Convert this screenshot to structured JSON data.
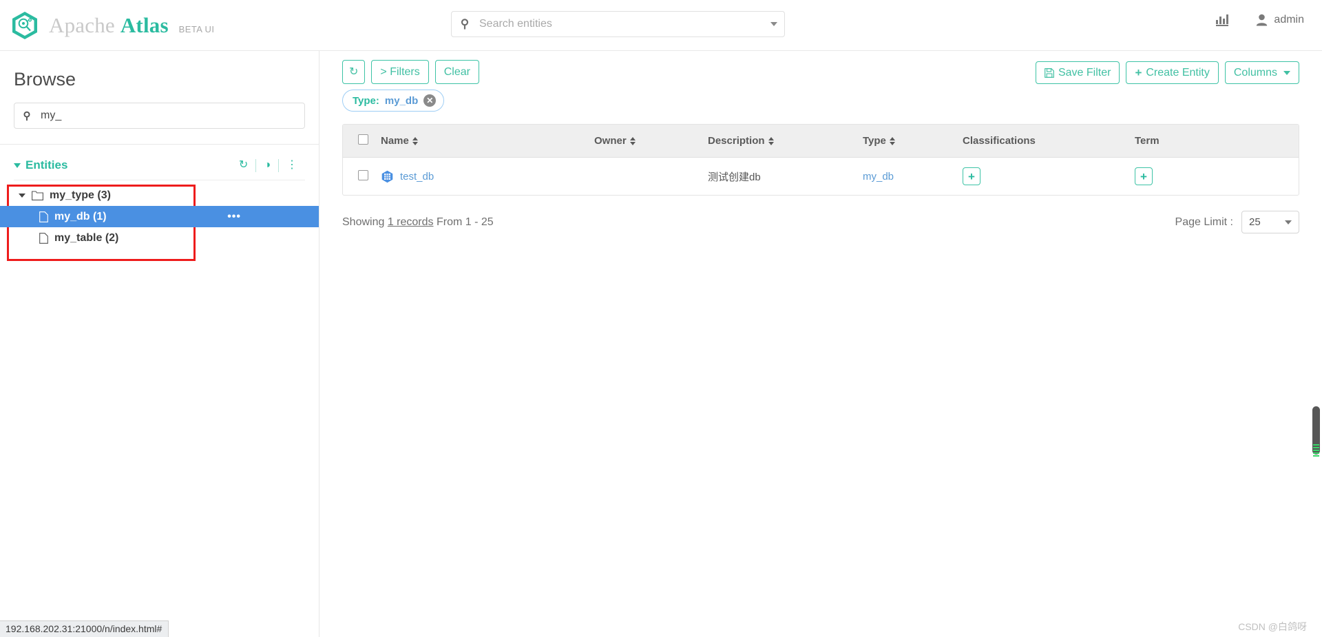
{
  "header": {
    "brand_apache": "Apache",
    "brand_atlas": "Atlas",
    "brand_beta": "BETA UI",
    "logo_icon": "hexagon-magnifier-icon",
    "search": {
      "placeholder": "Search entities",
      "value": "",
      "icon": "search-icon",
      "caret_icon": "chevron-down-icon"
    },
    "stats_icon": "bar-chart-icon",
    "user_icon": "user-icon",
    "user_name": "admin"
  },
  "sidebar": {
    "title": "Browse",
    "search": {
      "icon": "search-icon",
      "value": "my_",
      "placeholder": ""
    },
    "entities": {
      "label": "Entities",
      "caret_icon": "chevron-down-icon",
      "tools": [
        {
          "name": "refresh-icon",
          "glyph": "↻"
        },
        {
          "name": "toggle-icon",
          "glyph": "◑"
        },
        {
          "name": "more-vertical-icon",
          "glyph": "⋮"
        }
      ]
    },
    "tree": [
      {
        "label": "my_type (3)",
        "level": 1,
        "icon": "folder-icon",
        "caret_icon": "caret-down-icon",
        "selected": false,
        "dots": ""
      },
      {
        "label": "my_db (1)",
        "level": 2,
        "icon": "file-icon",
        "caret_icon": "",
        "selected": true,
        "dots": "•••"
      },
      {
        "label": "my_table (2)",
        "level": 2,
        "icon": "file-icon",
        "caret_icon": "",
        "selected": false,
        "dots": ""
      }
    ]
  },
  "toolbar": {
    "refresh_icon": "refresh-icon",
    "filters_label": "> Filters",
    "clear_label": "Clear",
    "save_filter_label": "Save Filter",
    "save_filter_icon": "floppy-disk-icon",
    "create_entity_label": "Create Entity",
    "create_entity_icon": "plus-icon",
    "columns_label": "Columns",
    "columns_caret_icon": "caret-down-icon"
  },
  "filter_chip": {
    "key": "Type:",
    "value": "my_db",
    "close_icon": "close-circle-icon"
  },
  "table": {
    "columns": [
      {
        "label": "Name",
        "sortable": true
      },
      {
        "label": "Owner",
        "sortable": true
      },
      {
        "label": "Description",
        "sortable": true
      },
      {
        "label": "Type",
        "sortable": true
      },
      {
        "label": "Classifications",
        "sortable": false
      },
      {
        "label": "Term",
        "sortable": false
      }
    ],
    "rows": [
      {
        "name": "test_db",
        "name_icon": "hexagon-table-icon",
        "owner": "",
        "description": "测试创建db",
        "type": "my_db",
        "classification_add": "+",
        "term_add": "+"
      }
    ]
  },
  "footer": {
    "showing_prefix": "Showing",
    "records": "1 records",
    "showing_suffix": "From 1 - 25",
    "page_limit_label": "Page Limit :",
    "page_limit_value": "25",
    "page_limit_caret": "caret-down-icon"
  },
  "status_bar": {
    "url": "192.168.202.31:21000/n/index.html#"
  },
  "watermark": "CSDN @白鸽呀",
  "colors": {
    "accent_teal": "#2bbba0",
    "link_blue": "#5b9bd5",
    "selected_blue": "#4a90e2",
    "highlight_red": "#ee1c1c"
  }
}
